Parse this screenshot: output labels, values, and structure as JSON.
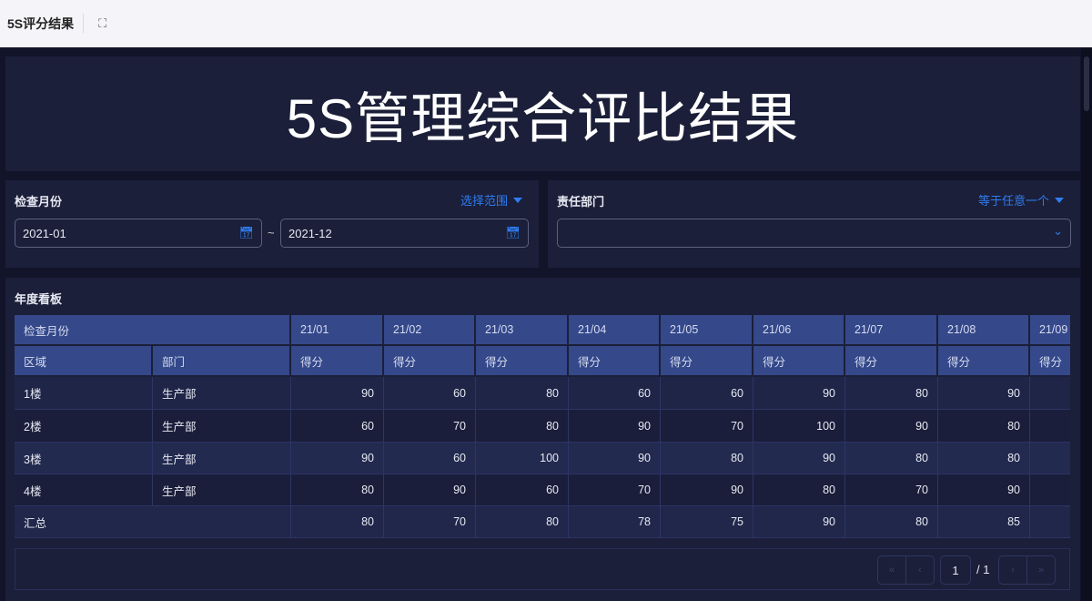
{
  "topbar": {
    "title": "5S评分结果",
    "expand_icon": "expand-icon"
  },
  "hero": {
    "title": "5S管理综合评比结果"
  },
  "filters": {
    "month": {
      "label": "检查月份",
      "mode": "选择范围",
      "start": "2021-01",
      "end": "2021-12",
      "separator": "~"
    },
    "dept": {
      "label": "责任部门",
      "mode": "等于任意一个",
      "value": ""
    }
  },
  "table": {
    "title": "年度看板",
    "header_month_label": "检查月份",
    "header_area": "区域",
    "header_dept": "部门",
    "score_label": "得分",
    "months": [
      "21/01",
      "21/02",
      "21/03",
      "21/04",
      "21/05",
      "21/06",
      "21/07",
      "21/08",
      "21/09"
    ],
    "rows": [
      {
        "area": "1楼",
        "dept": "生产部",
        "scores": [
          90,
          60,
          80,
          60,
          60,
          90,
          80,
          90,
          ""
        ]
      },
      {
        "area": "2楼",
        "dept": "生产部",
        "scores": [
          60,
          70,
          80,
          90,
          70,
          100,
          90,
          80,
          ""
        ]
      },
      {
        "area": "3楼",
        "dept": "生产部",
        "scores": [
          90,
          60,
          100,
          90,
          80,
          90,
          80,
          80,
          ""
        ]
      },
      {
        "area": "4楼",
        "dept": "生产部",
        "scores": [
          80,
          90,
          60,
          70,
          90,
          80,
          70,
          90,
          ""
        ]
      }
    ],
    "total": {
      "label": "汇总",
      "scores": [
        80,
        70,
        80,
        78,
        75,
        90,
        80,
        85,
        ""
      ]
    }
  },
  "pager": {
    "page": "1",
    "total": "/ 1"
  }
}
